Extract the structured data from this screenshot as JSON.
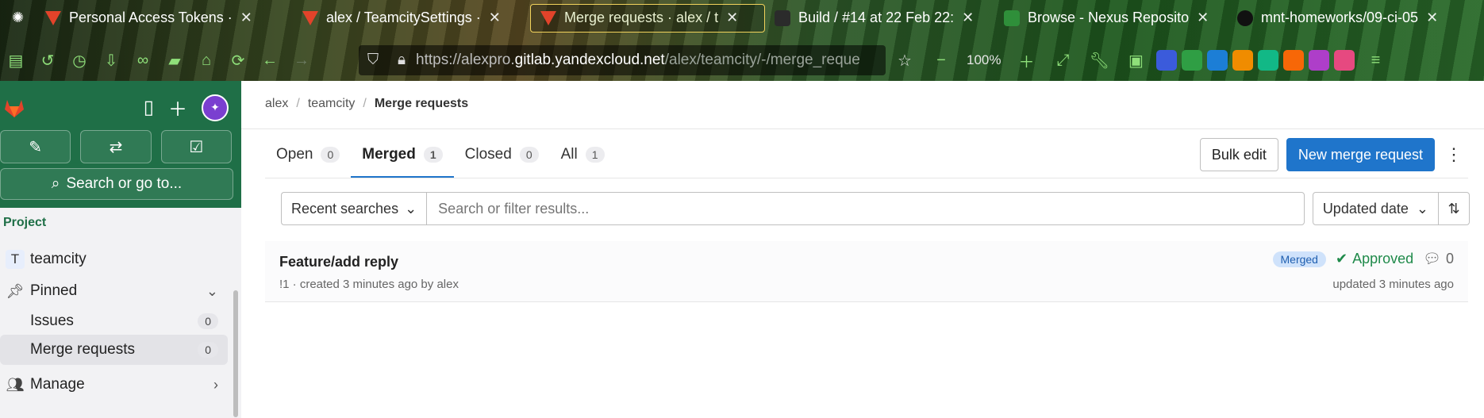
{
  "browser": {
    "tabs": [
      {
        "title": "Personal Access Tokens ·",
        "active": false
      },
      {
        "title": "alex / TeamcitySettings ·",
        "active": false
      },
      {
        "title": "Merge requests · alex / t",
        "active": true
      },
      {
        "title": "Build / #14 at 22 Feb 22:",
        "active": false
      },
      {
        "title": "Browse - Nexus Reposito",
        "active": false
      },
      {
        "title": "mnt-homeworks/09-ci-05",
        "active": false
      }
    ],
    "url": {
      "prefix": "https://alexpro.",
      "host": "gitlab.yandexcloud.net",
      "path": "/alex/teamcity/-/merge_reque"
    },
    "zoom": "100%"
  },
  "sidebar": {
    "search_label": "Search or go to...",
    "section_label": "Project",
    "project_badge": "T",
    "project_name": "teamcity",
    "pinned_label": "Pinned",
    "items": [
      {
        "label": "Issues",
        "count": "0"
      },
      {
        "label": "Merge requests",
        "count": "0"
      }
    ],
    "manage_label": "Manage"
  },
  "breadcrumb": {
    "items": [
      "alex",
      "teamcity",
      "Merge requests"
    ]
  },
  "tabs": [
    {
      "label": "Open",
      "count": "0"
    },
    {
      "label": "Merged",
      "count": "1"
    },
    {
      "label": "Closed",
      "count": "0"
    },
    {
      "label": "All",
      "count": "1"
    }
  ],
  "actions": {
    "bulk_edit": "Bulk edit",
    "new_mr": "New merge request"
  },
  "filter": {
    "recent_searches": "Recent searches",
    "placeholder": "Search or filter results...",
    "sort_label": "Updated date"
  },
  "merge_request": {
    "title": "Feature/add reply",
    "meta": "!1 · created 3 minutes ago by alex",
    "status": "Merged",
    "approval": "Approved",
    "comments": "0",
    "updated": "updated 3 minutes ago"
  }
}
